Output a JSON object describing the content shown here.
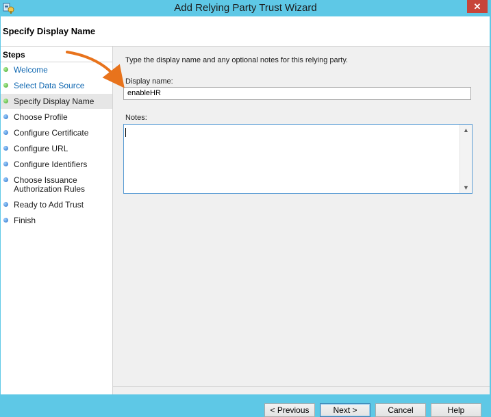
{
  "window": {
    "title": "Add Relying Party Trust Wizard",
    "close_label": "✕"
  },
  "header": {
    "title": "Specify Display Name"
  },
  "steps": {
    "title": "Steps",
    "items": [
      {
        "label": "Welcome",
        "state": "done"
      },
      {
        "label": "Select Data Source",
        "state": "done"
      },
      {
        "label": "Specify Display Name",
        "state": "current"
      },
      {
        "label": "Choose Profile",
        "state": "pending"
      },
      {
        "label": "Configure Certificate",
        "state": "pending"
      },
      {
        "label": "Configure URL",
        "state": "pending"
      },
      {
        "label": "Configure Identifiers",
        "state": "pending"
      },
      {
        "label": "Choose Issuance",
        "label2": "Authorization Rules",
        "state": "pending"
      },
      {
        "label": "Ready to Add Trust",
        "state": "pending"
      },
      {
        "label": "Finish",
        "state": "pending"
      }
    ]
  },
  "content": {
    "instruction": "Type the display name and any optional notes for this relying party.",
    "display_name_label": "Display name:",
    "display_name_value": "enableHR",
    "notes_label": "Notes:",
    "notes_value": ""
  },
  "buttons": {
    "previous": "< Previous",
    "next": "Next >",
    "cancel": "Cancel",
    "help": "Help"
  },
  "colors": {
    "titlebar": "#5ec8e6",
    "annotation_arrow": "#e8731c",
    "done_dot": "#3fa32b",
    "pending_dot": "#2a6fc6",
    "link_text": "#0d66b0"
  }
}
